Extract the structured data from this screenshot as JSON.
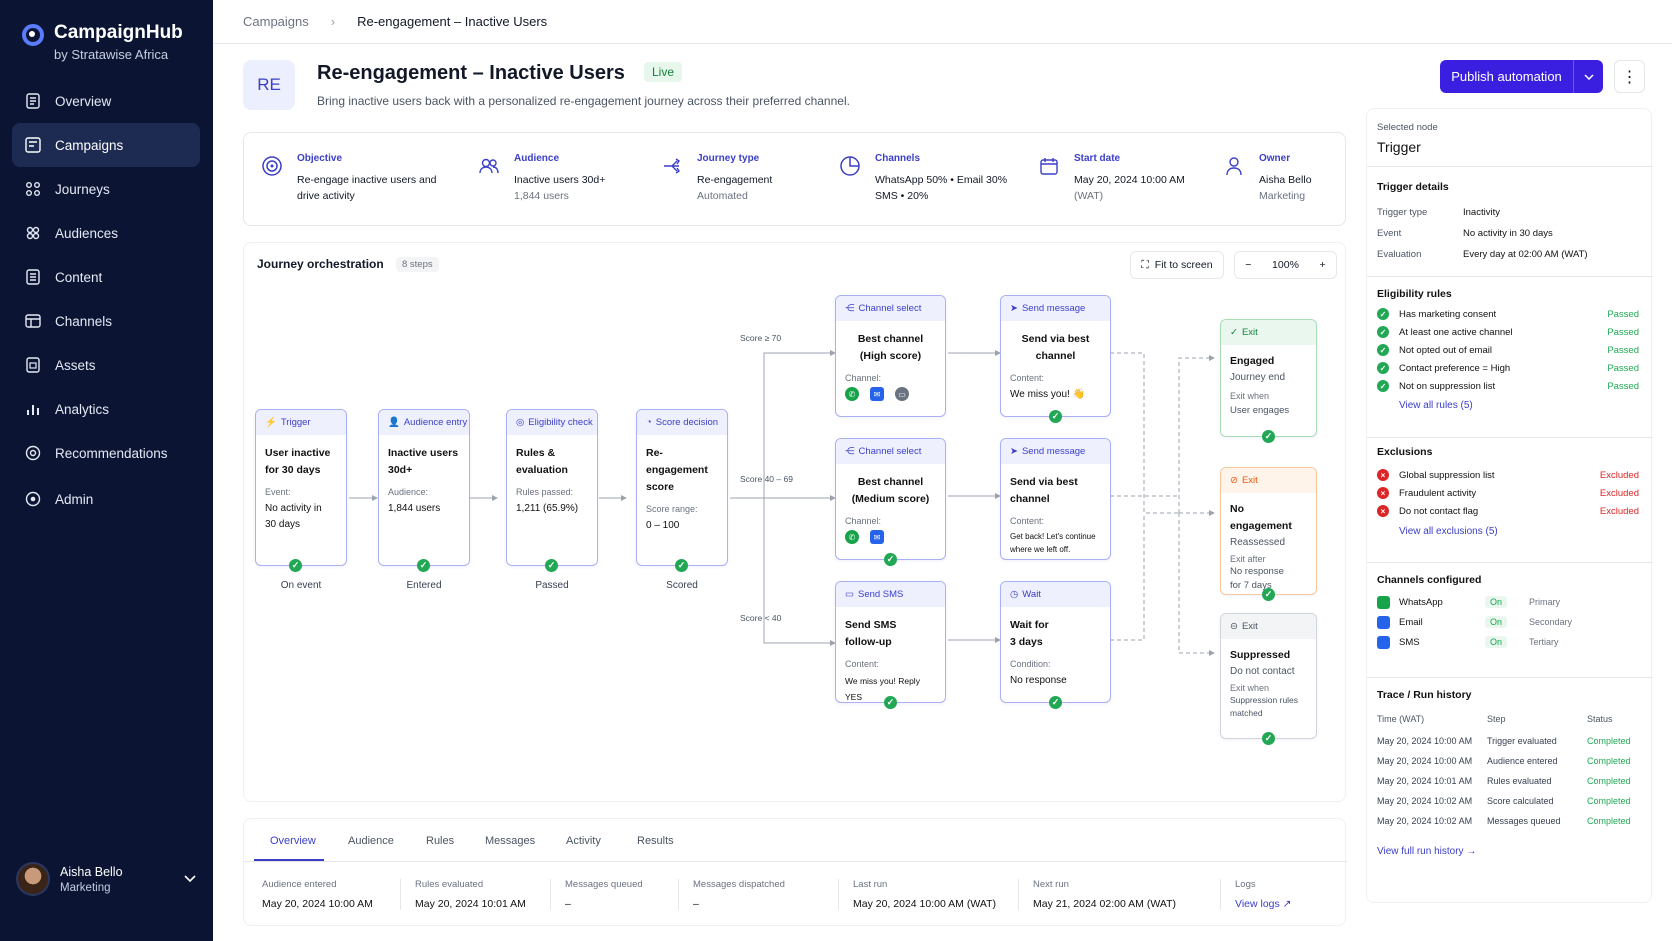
{
  "app": {
    "name": "CampaignHub",
    "org": "by Stratawise Africa"
  },
  "nav": [
    {
      "label": "Overview",
      "icon": "overview-icon"
    },
    {
      "label": "Campaigns",
      "icon": "campaigns-icon",
      "active": true
    },
    {
      "label": "Journeys",
      "icon": "journeys-icon"
    },
    {
      "label": "Audiences",
      "icon": "audiences-icon"
    },
    {
      "label": "Content",
      "icon": "content-icon"
    },
    {
      "label": "Channels",
      "icon": "channels-icon"
    },
    {
      "label": "Assets",
      "icon": "assets-icon"
    },
    {
      "label": "Analytics",
      "icon": "analytics-icon"
    },
    {
      "label": "Recommendations",
      "icon": "recommendations-icon"
    },
    {
      "label": "Admin",
      "icon": "admin-icon"
    }
  ],
  "user": {
    "name": "Aisha Bello",
    "role": "Marketing"
  },
  "breadcrumb": {
    "parent": "Campaigns",
    "current": "Re-engagement – Inactive Users"
  },
  "header": {
    "badge": "RE",
    "title": "Re-engagement – Inactive Users",
    "status": "Live",
    "subtitle": "Bring inactive users back with a personalized re-engagement journey across their preferred channel.",
    "publish_label": "Publish automation"
  },
  "summary": {
    "objective": {
      "label": "Objective",
      "line1": "Re-engage inactive users and",
      "line2": "drive activity"
    },
    "audience": {
      "label": "Audience",
      "line1": "Inactive users 30d+",
      "line2": "1,844 users"
    },
    "journey_type": {
      "label": "Journey type",
      "line1": "Re-engagement",
      "line2": "Automated"
    },
    "channels": {
      "label": "Channels",
      "line1": "WhatsApp 50% • Email 30%",
      "line2": "SMS • 20%"
    },
    "start_date": {
      "label": "Start date",
      "line1": "May 20, 2024 10:00 AM",
      "line2": "(WAT)"
    },
    "owner": {
      "label": "Owner",
      "line1": "Aisha Bello",
      "line2": "Marketing"
    }
  },
  "canvas": {
    "title": "Journey orchestration",
    "steps": "8 steps",
    "fit_label": "Fit to screen",
    "zoom": "100%",
    "minus": "−",
    "plus": "+",
    "edges": {
      "high": "Score ≥ 70",
      "mid": "Score 40 – 69",
      "low": "Score < 40"
    },
    "nodes": {
      "trigger": {
        "type": "Trigger",
        "title1": "User inactive",
        "title2": "for 30 days",
        "label": "Event:",
        "v1": "No activity in",
        "v2": "30 days",
        "caption": "On event"
      },
      "audience": {
        "type": "Audience entry",
        "title1": "Inactive users",
        "title2": "30d+",
        "label": "Audience:",
        "v1": "1,844 users",
        "caption": "Entered"
      },
      "eligibility": {
        "type": "Eligibility check",
        "title1": "Rules &",
        "title2": "evaluation",
        "label": "Rules passed:",
        "v1": "1,211 (65.9%)",
        "caption": "Passed"
      },
      "score": {
        "type": "Score decision",
        "title1": "Re-engagement",
        "title2": "score",
        "label": "Score range:",
        "v1": "0 – 100",
        "caption": "Scored"
      },
      "ch_high": {
        "type": "Channel select",
        "title1": "Best channel",
        "title2": "(High score)",
        "label": "Channel:"
      },
      "ch_mid": {
        "type": "Channel select",
        "title1": "Best channel",
        "title2": "(Medium score)",
        "label": "Channel:"
      },
      "sms": {
        "type": "Send SMS",
        "title1": "Send SMS",
        "title2": "follow-up",
        "label": "Content:",
        "v1": "We miss you! Reply YES"
      },
      "msg_high": {
        "type": "Send message",
        "title1": "Send via best",
        "title2": "channel",
        "label": "Content:",
        "v1": "We miss you! 👋"
      },
      "msg_mid": {
        "type": "Send message",
        "title1": "Send via best",
        "title2": "channel",
        "label": "Content:",
        "v1": "Get back! Let's continue",
        "v2": "where we left off."
      },
      "wait": {
        "type": "Wait",
        "title1": "Wait for",
        "title2": "3 days",
        "label": "Condition:",
        "v1": "No response"
      },
      "exit_engaged": {
        "type": "Exit",
        "title": "Engaged",
        "sub": "Journey end",
        "label": "Exit when",
        "v1": "User engages"
      },
      "exit_noeng": {
        "type": "Exit",
        "title": "No engagement",
        "sub": "Reassessed",
        "label": "Exit after",
        "v1": "No response",
        "v2": "for 7 days"
      },
      "exit_supp": {
        "type": "Exit",
        "title": "Suppressed",
        "sub": "Do not contact",
        "label": "Exit when",
        "v1": "Suppression rules",
        "v2": "matched"
      }
    }
  },
  "tabs": [
    "Overview",
    "Audience",
    "Rules",
    "Messages",
    "Activity",
    "Results"
  ],
  "metrics": [
    {
      "label": "Audience entered",
      "value": "May 20, 2024 10:00 AM"
    },
    {
      "label": "Rules evaluated",
      "value": "May 20, 2024 10:01 AM"
    },
    {
      "label": "Messages queued",
      "value": "–"
    },
    {
      "label": "Messages dispatched",
      "value": "–"
    },
    {
      "label": "Last run",
      "value": "May 20, 2024 10:00 AM (WAT)"
    },
    {
      "label": "Next run",
      "value": "May 21, 2024 02:00 AM (WAT)"
    },
    {
      "label": "Logs",
      "value": "View logs"
    }
  ],
  "panel": {
    "selected_label": "Selected node",
    "selected_value": "Trigger",
    "trigger_title": "Trigger details",
    "trigger": [
      {
        "k": "Trigger type",
        "v": "Inactivity"
      },
      {
        "k": "Event",
        "v": "No activity in 30 days"
      },
      {
        "k": "Evaluation",
        "v": "Every day at 02:00 AM (WAT)"
      }
    ],
    "elig_title": "Eligibility rules",
    "rules": [
      {
        "t": "Has marketing consent",
        "s": "Passed"
      },
      {
        "t": "At least one active channel",
        "s": "Passed"
      },
      {
        "t": "Not opted out of email",
        "s": "Passed"
      },
      {
        "t": "Contact preference = High",
        "s": "Passed"
      },
      {
        "t": "Not on suppression list",
        "s": "Passed"
      }
    ],
    "rules_link": "View all rules (5)",
    "excl_title": "Exclusions",
    "exclusions": [
      {
        "t": "Global suppression list",
        "s": "Excluded"
      },
      {
        "t": "Fraudulent activity",
        "s": "Excluded"
      },
      {
        "t": "Do not contact flag",
        "s": "Excluded"
      }
    ],
    "excl_link": "View all exclusions (5)",
    "chan_title": "Channels configured",
    "channels": [
      {
        "name": "WhatsApp",
        "state": "On",
        "level": "Primary"
      },
      {
        "name": "Email",
        "state": "On",
        "level": "Secondary"
      },
      {
        "name": "SMS",
        "state": "On",
        "level": "Tertiary"
      }
    ],
    "trace_title": "Trace / Run history",
    "trace_headers": [
      "Time (WAT)",
      "Step",
      "Status"
    ],
    "trace": [
      {
        "time": "May 20, 2024 10:00 AM",
        "step": "Trigger evaluated",
        "status": "Completed"
      },
      {
        "time": "May 20, 2024 10:00 AM",
        "step": "Audience entered",
        "status": "Completed"
      },
      {
        "time": "May 20, 2024 10:01 AM",
        "step": "Rules evaluated",
        "status": "Completed"
      },
      {
        "time": "May 20, 2024 10:02 AM",
        "step": "Score calculated",
        "status": "Completed"
      },
      {
        "time": "May 20, 2024 10:02 AM",
        "step": "Messages queued",
        "status": "Completed"
      }
    ],
    "trace_link": "View full run history"
  }
}
